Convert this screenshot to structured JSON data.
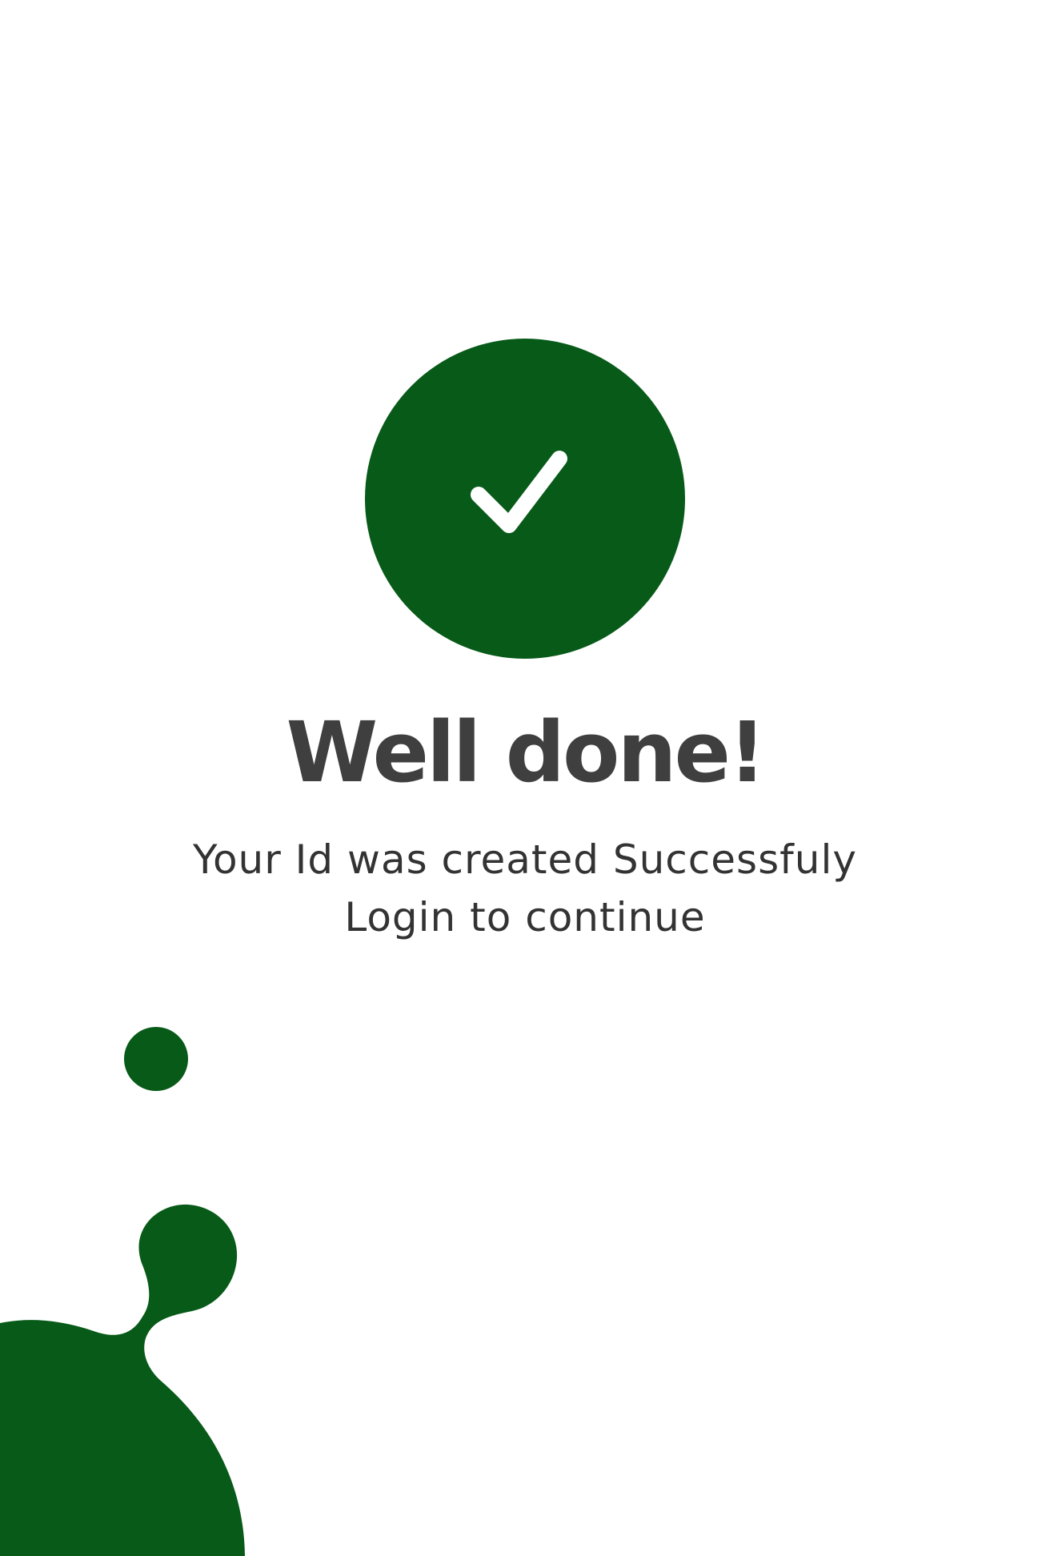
{
  "colors": {
    "accent": "#075a18",
    "title": "#3f3f3f",
    "message": "#333333",
    "background": "#ffffff"
  },
  "icons": {
    "badge": "check-icon"
  },
  "screen": {
    "title": "Well done!",
    "message_line1": "Your Id was created Successfuly",
    "message_line2": "Login to continue"
  }
}
